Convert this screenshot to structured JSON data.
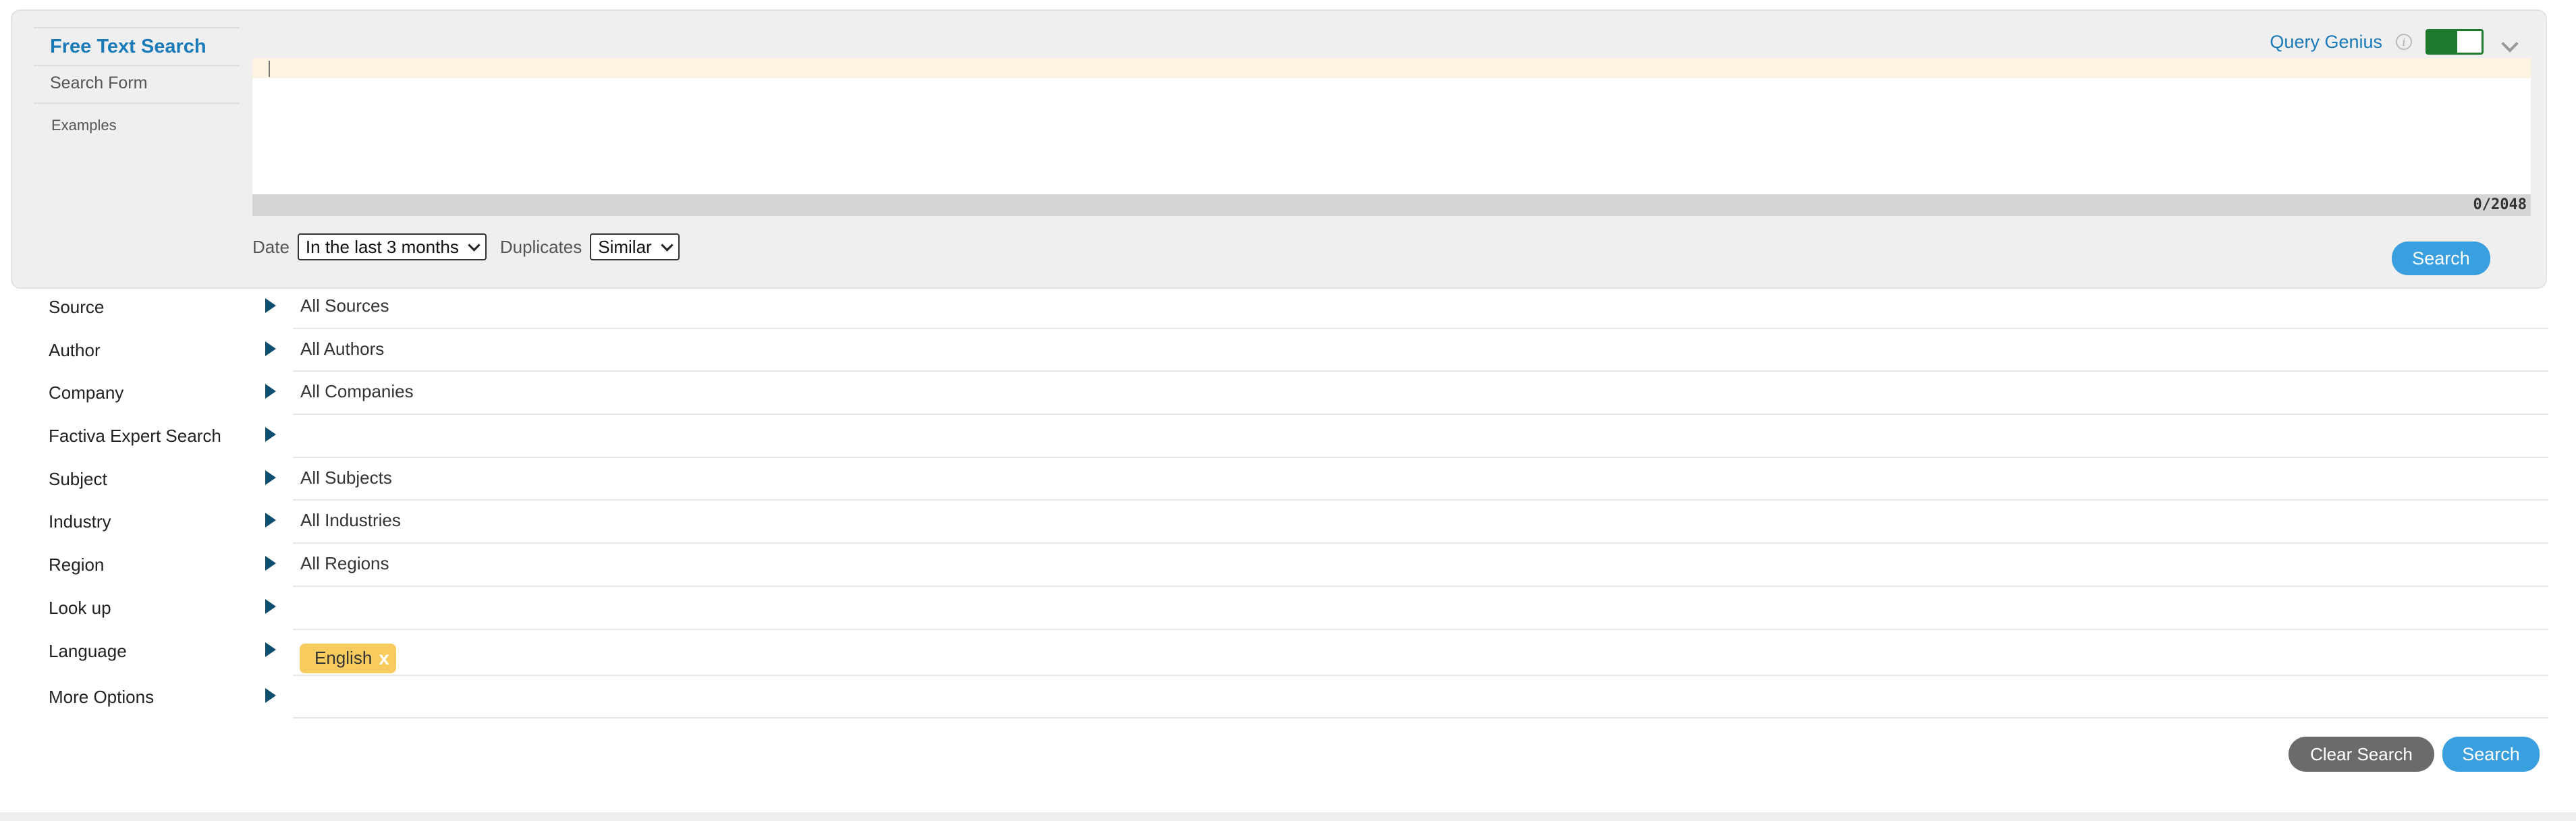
{
  "left_nav": {
    "active": "Free Text Search",
    "form": "Search Form",
    "examples": "Examples"
  },
  "query_genius": {
    "label": "Query Genius",
    "info_icon": "info-icon",
    "toggle_on": true
  },
  "editor": {
    "counter": "0/2048"
  },
  "filters": {
    "date_label": "Date",
    "date_value": "In the last 3 months",
    "duplicates_label": "Duplicates",
    "duplicates_value": "Similar"
  },
  "search_label": "Search",
  "rows": [
    {
      "label": "Source",
      "value": "All Sources"
    },
    {
      "label": "Author",
      "value": "All Authors"
    },
    {
      "label": "Company",
      "value": "All Companies"
    },
    {
      "label": "Factiva Expert Search",
      "value": ""
    },
    {
      "label": "Subject",
      "value": "All Subjects"
    },
    {
      "label": "Industry",
      "value": "All Industries"
    },
    {
      "label": "Region",
      "value": "All Regions"
    },
    {
      "label": "Look up",
      "value": ""
    },
    {
      "label": "Language",
      "tag": "English",
      "tag_close": "x"
    },
    {
      "label": "More Options",
      "value": ""
    }
  ],
  "buttons": {
    "clear": "Clear Search",
    "search": "Search"
  },
  "colors": {
    "accent": "#1a7bb8",
    "button_blue": "#3a9fdf",
    "tag": "#f8cb5e",
    "toggle": "#1d7a2c"
  }
}
